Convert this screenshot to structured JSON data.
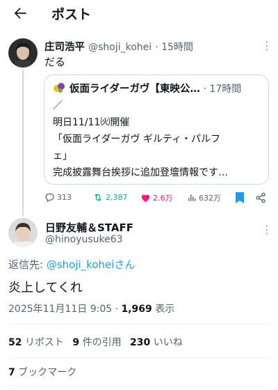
{
  "header": {
    "title": "ポスト"
  },
  "parent_post": {
    "display_name": "庄司浩平",
    "handle": "@shoji_kohei",
    "time": "· 15時間",
    "text": "だる",
    "quote": {
      "account_name": "仮面ライダーガヴ【東映公…",
      "time": "· 17時間",
      "lines": [
        "／",
        "明日11/11㈫開催",
        "「仮面ライダーガヴ ギルティ・パルフ",
        "ェ」",
        "完成披露舞台挨拶に追加登壇情報です…"
      ]
    },
    "actions": {
      "replies": "313",
      "reposts": "2,387",
      "likes": "2.6万",
      "views": "632万"
    }
  },
  "main_post": {
    "display_name": "日野友輔＆STAFF",
    "handle": "@hinoyusuke63",
    "reply_prefix": "返信先: ",
    "reply_to": "@shoji_kohei",
    "reply_suffix": "さん",
    "text": "炎上してくれ",
    "timestamp": "2025年11月11日 9:05 · ",
    "views_count": "1,969",
    "views_label": " 表示",
    "stats": {
      "reposts_count": "52",
      "reposts_label": "リポスト",
      "quotes_count": "9",
      "quotes_label": "件の引用",
      "likes_count": "230",
      "likes_label": "いいね",
      "bookmarks_count": "7",
      "bookmarks_label": "ブックマーク"
    }
  },
  "colors": {
    "accent": "#1d9bf0",
    "repost_green": "#00ba7c",
    "like_pink": "#f91880",
    "muted": "#536471"
  }
}
